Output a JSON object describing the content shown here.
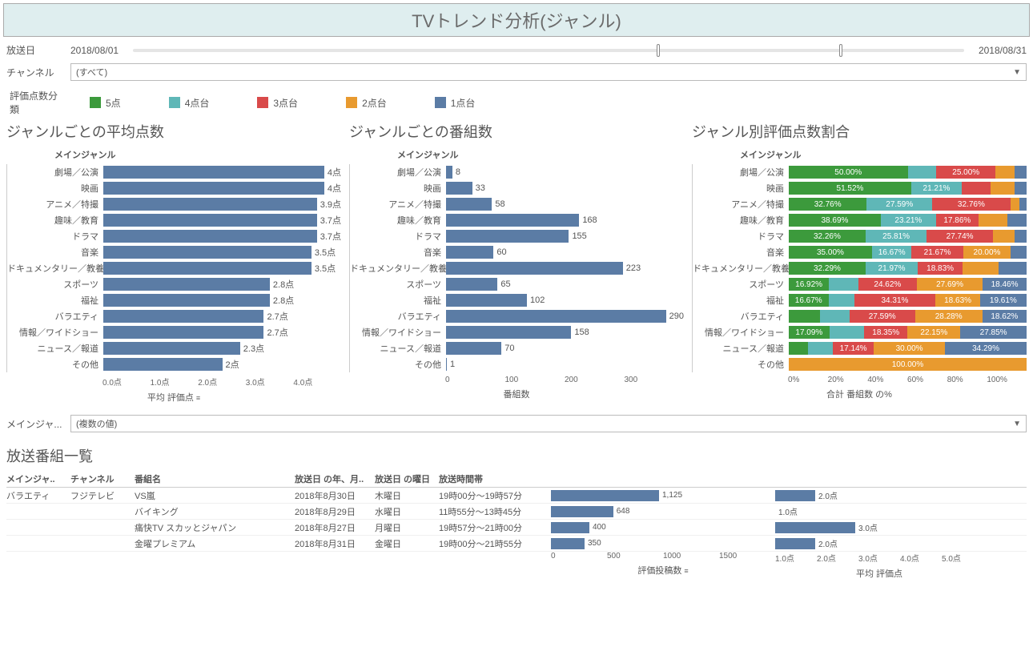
{
  "title": "TVトレンド分析(ジャンル)",
  "filters": {
    "date_label": "放送日",
    "date_start": "2018/08/01",
    "date_end": "2018/08/31",
    "channel_label": "チャンネル",
    "channel_value": "(すべて)",
    "rating_class_label": "評価点数分類",
    "main_genre_filter_label": "メインジャ...",
    "main_genre_filter_value": "(複数の値)"
  },
  "legend": [
    {
      "label": "5点",
      "color": "#3c9a3c"
    },
    {
      "label": "4点台",
      "color": "#5fb7b7"
    },
    {
      "label": "3点台",
      "color": "#d94a4a"
    },
    {
      "label": "2点台",
      "color": "#e89a2f"
    },
    {
      "label": "1点台",
      "color": "#5b7ca5"
    }
  ],
  "chart_data": [
    {
      "id": "avg_score",
      "type": "bar",
      "title": "ジャンルごとの平均点数",
      "subhead": "メインジャンル",
      "xlabel": "平均 評価点",
      "xlim": [
        0,
        4.0
      ],
      "ticks": [
        "0.0点",
        "1.0点",
        "2.0点",
        "3.0点",
        "4.0点"
      ],
      "categories": [
        "劇場／公演",
        "映画",
        "アニメ／特撮",
        "趣味／教育",
        "ドラマ",
        "音楽",
        "ドキュメンタリー／教養",
        "スポーツ",
        "福祉",
        "バラエティ",
        "情報／ワイドショー",
        "ニュース／報道",
        "その他"
      ],
      "values": [
        4.0,
        4.0,
        3.9,
        3.7,
        3.7,
        3.5,
        3.5,
        2.8,
        2.8,
        2.7,
        2.7,
        2.3,
        2.0
      ],
      "value_suffix": "点"
    },
    {
      "id": "program_count",
      "type": "bar",
      "title": "ジャンルごとの番組数",
      "subhead": "メインジャンル",
      "xlabel": "番組数",
      "xlim": [
        0,
        300
      ],
      "ticks": [
        "0",
        "100",
        "200",
        "300"
      ],
      "categories": [
        "劇場／公演",
        "映画",
        "アニメ／特撮",
        "趣味／教育",
        "ドラマ",
        "音楽",
        "ドキュメンタリー／教養",
        "スポーツ",
        "福祉",
        "バラエティ",
        "情報／ワイドショー",
        "ニュース／報道",
        "その他"
      ],
      "values": [
        8,
        33,
        58,
        168,
        155,
        60,
        223,
        65,
        102,
        290,
        158,
        70,
        1
      ],
      "value_suffix": ""
    },
    {
      "id": "rating_breakdown",
      "type": "stacked_bar_pct",
      "title": "ジャンル別評価点数割合",
      "subhead": "メインジャンル",
      "xlabel": "合計 番組数 の%",
      "xlim": [
        0,
        100
      ],
      "ticks": [
        "0%",
        "20%",
        "40%",
        "60%",
        "80%",
        "100%"
      ],
      "categories": [
        "劇場／公演",
        "映画",
        "アニメ／特撮",
        "趣味／教育",
        "ドラマ",
        "音楽",
        "ドキュメンタリー／教養",
        "スポーツ",
        "福祉",
        "バラエティ",
        "情報／ワイドショー",
        "ニュース／報道",
        "その他"
      ],
      "series_colors": {
        "5": "#3c9a3c",
        "4": "#5fb7b7",
        "3": "#d94a4a",
        "2": "#e89a2f",
        "1": "#5b7ca5"
      },
      "series": [
        {
          "5": 50.0,
          "4": 12.0,
          "3": 25.0,
          "2": 8.0,
          "1": 5.0,
          "show": {
            "5": "50.00%",
            "3": "25.00%"
          }
        },
        {
          "5": 51.52,
          "4": 21.21,
          "3": 12.0,
          "2": 10.27,
          "1": 5.0,
          "show": {
            "5": "51.52%",
            "4": "21.21%"
          }
        },
        {
          "5": 32.76,
          "4": 27.59,
          "3": 32.76,
          "2": 3.89,
          "1": 3.0,
          "show": {
            "5": "32.76%",
            "4": "27.59%",
            "3": "32.76%"
          }
        },
        {
          "5": 38.69,
          "4": 23.21,
          "3": 17.86,
          "2": 12.24,
          "1": 8.0,
          "show": {
            "5": "38.69%",
            "4": "23.21%",
            "3": "17.86%"
          }
        },
        {
          "5": 32.26,
          "4": 25.81,
          "3": 27.74,
          "2": 9.19,
          "1": 5.0,
          "show": {
            "5": "32.26%",
            "4": "25.81%",
            "3": "27.74%"
          }
        },
        {
          "5": 35.0,
          "4": 16.67,
          "3": 21.67,
          "2": 20.0,
          "1": 6.66,
          "show": {
            "5": "35.00%",
            "4": "16.67%",
            "3": "21.67%",
            "2": "20.00%"
          }
        },
        {
          "5": 32.29,
          "4": 21.97,
          "3": 18.83,
          "2": 15.0,
          "1": 11.91,
          "show": {
            "5": "32.29%",
            "4": "21.97%",
            "3": "18.83%"
          }
        },
        {
          "5": 16.92,
          "4": 12.31,
          "3": 24.62,
          "2": 27.69,
          "1": 18.46,
          "show": {
            "5": "16.92%",
            "3": "24.62%",
            "2": "27.69%",
            "1": "18.46%"
          }
        },
        {
          "5": 16.67,
          "4": 10.78,
          "3": 34.31,
          "2": 18.63,
          "1": 19.61,
          "show": {
            "5": "16.67%",
            "3": "34.31%",
            "2": "18.63%",
            "1": "19.61%"
          }
        },
        {
          "5": 13.0,
          "4": 12.51,
          "3": 27.59,
          "2": 28.28,
          "1": 18.62,
          "show": {
            "3": "27.59%",
            "2": "28.28%",
            "1": "18.62%"
          }
        },
        {
          "5": 17.09,
          "4": 14.56,
          "3": 18.35,
          "2": 22.15,
          "1": 27.85,
          "show": {
            "5": "17.09%",
            "3": "18.35%",
            "2": "22.15%",
            "1": "27.85%"
          }
        },
        {
          "5": 8.0,
          "4": 10.57,
          "3": 17.14,
          "2": 30.0,
          "1": 34.29,
          "show": {
            "3": "17.14%",
            "2": "30.00%",
            "1": "34.29%"
          }
        },
        {
          "5": 0,
          "4": 0,
          "3": 0,
          "2": 100.0,
          "1": 0,
          "show": {
            "2": "100.00%"
          }
        }
      ]
    },
    {
      "id": "program_list_posts",
      "type": "bar",
      "xlabel": "評価投稿数",
      "xlim": [
        0,
        2000
      ],
      "ticks": [
        "0",
        "500",
        "1000",
        "1500"
      ]
    },
    {
      "id": "program_list_avg",
      "type": "bar",
      "xlabel": "平均 評価点",
      "xlim": [
        1.0,
        5.0
      ],
      "ticks": [
        "1.0点",
        "2.0点",
        "3.0点",
        "4.0点",
        "5.0点"
      ]
    }
  ],
  "program_table": {
    "title": "放送番組一覧",
    "headers": {
      "genre": "メインジャ..",
      "channel": "チャンネル",
      "program": "番組名",
      "date": "放送日 の年、月..",
      "dow": "放送日 の曜日",
      "time": "放送時間帯"
    },
    "genre_group": "バラエティ",
    "channel_group": "フジテレビ",
    "rows": [
      {
        "program": "VS嵐",
        "date": "2018年8月30日",
        "dow": "木曜日",
        "time": "19時00分～19時57分",
        "posts": 1125,
        "avg": 2.0
      },
      {
        "program": "バイキング",
        "date": "2018年8月29日",
        "dow": "水曜日",
        "time": "11時55分～13時45分",
        "posts": 648,
        "avg": 1.0
      },
      {
        "program": "痛快TV スカッとジャパン",
        "date": "2018年8月27日",
        "dow": "月曜日",
        "time": "19時57分～21時00分",
        "posts": 400,
        "avg": 3.0
      },
      {
        "program": "金曜プレミアム",
        "date": "2018年8月31日",
        "dow": "金曜日",
        "time": "19時00分～21時55分",
        "posts": 350,
        "avg": 2.0
      }
    ]
  }
}
